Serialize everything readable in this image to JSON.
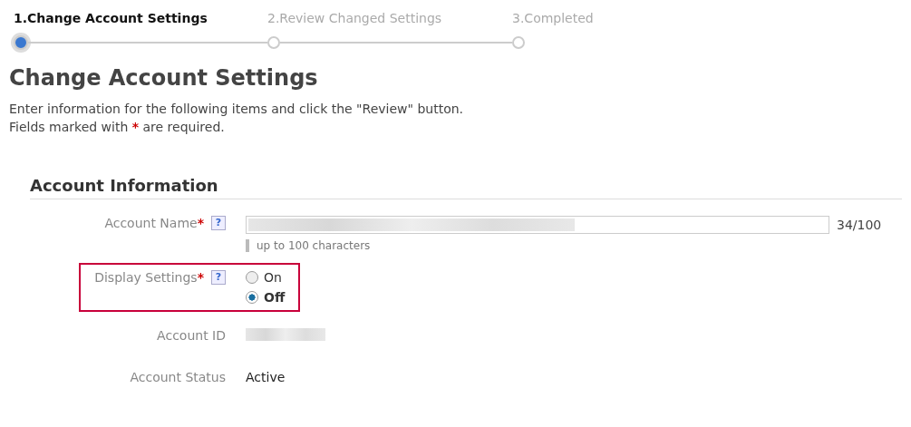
{
  "steps": [
    {
      "label": "1.Change Account Settings",
      "selected": true
    },
    {
      "label": "2.Review Changed Settings",
      "selected": false
    },
    {
      "label": "3.Completed",
      "selected": false
    }
  ],
  "heading": "Change Account Settings",
  "intro": "Enter information for the following items and click the \"Review\" button.",
  "required_note": {
    "before": "Fields marked with",
    "mark": "*",
    "after": "are required."
  },
  "section": {
    "title": "Account Information",
    "fields": [
      {
        "kind": "text",
        "label": "Account Name",
        "required": true,
        "help": "?",
        "highlighted": false,
        "counter": "34/100",
        "hint": "up to 100 characters"
      },
      {
        "kind": "radio",
        "label": "Display Settings",
        "required": true,
        "help": "?",
        "highlighted": true,
        "options": [
          {
            "label": "On",
            "selected": false
          },
          {
            "label": "Off",
            "selected": true
          }
        ]
      },
      {
        "kind": "hidden",
        "label": "Account ID",
        "required": false,
        "highlighted": false
      },
      {
        "kind": "value",
        "label": "Account Status",
        "required": false,
        "highlighted": false,
        "value": "Active"
      }
    ]
  }
}
